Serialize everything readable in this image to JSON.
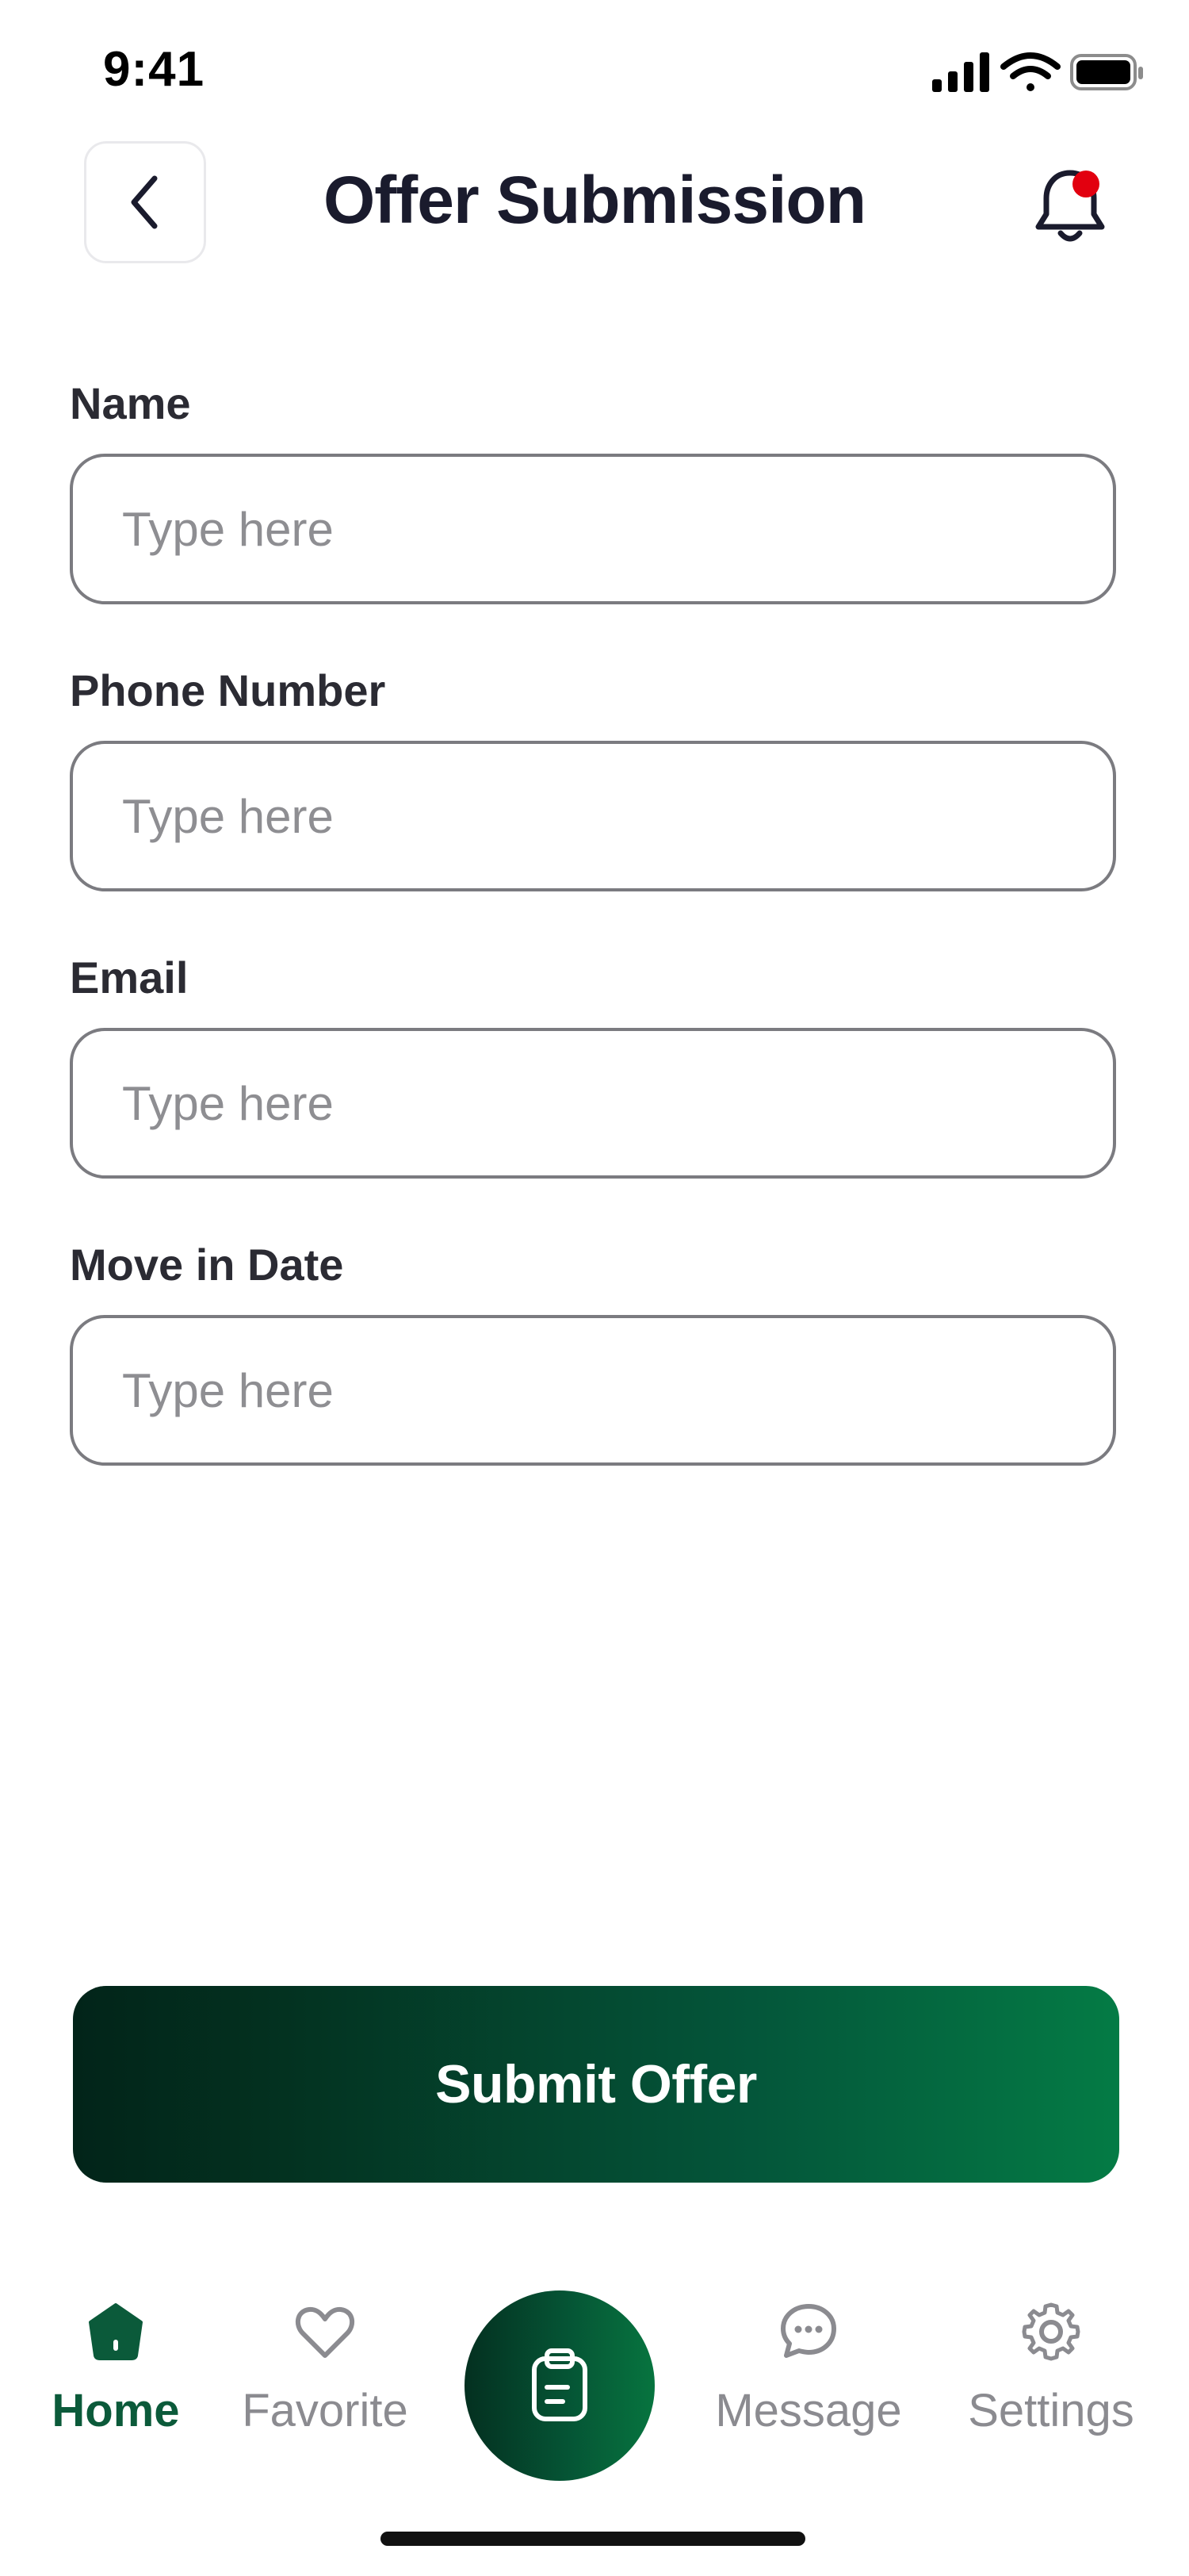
{
  "status_bar": {
    "time": "9:41"
  },
  "header": {
    "title": "Offer Submission",
    "has_notification": true,
    "notification_dot_color": "#e2000f"
  },
  "form": {
    "fields": [
      {
        "label": "Name",
        "value": "",
        "placeholder": "Type here"
      },
      {
        "label": "Phone Number",
        "value": "",
        "placeholder": "Type here"
      },
      {
        "label": "Email",
        "value": "",
        "placeholder": "Type here"
      },
      {
        "label": "Move in Date",
        "value": "",
        "placeholder": "Type here"
      }
    ]
  },
  "submit": {
    "label": "Submit Offer"
  },
  "nav": {
    "items": [
      {
        "label": "Home",
        "icon": "home-icon",
        "active": true
      },
      {
        "label": "Favorite",
        "icon": "heart-icon",
        "active": false
      },
      {
        "label": "",
        "icon": "clipboard-icon",
        "active": false
      },
      {
        "label": "Message",
        "icon": "chat-icon",
        "active": false
      },
      {
        "label": "Settings",
        "icon": "gear-icon",
        "active": false
      }
    ]
  },
  "colors": {
    "brand_dark": "#022419",
    "brand": "#047b45",
    "active_nav": "#0b5a3a",
    "inactive_nav": "#8b8b90"
  }
}
